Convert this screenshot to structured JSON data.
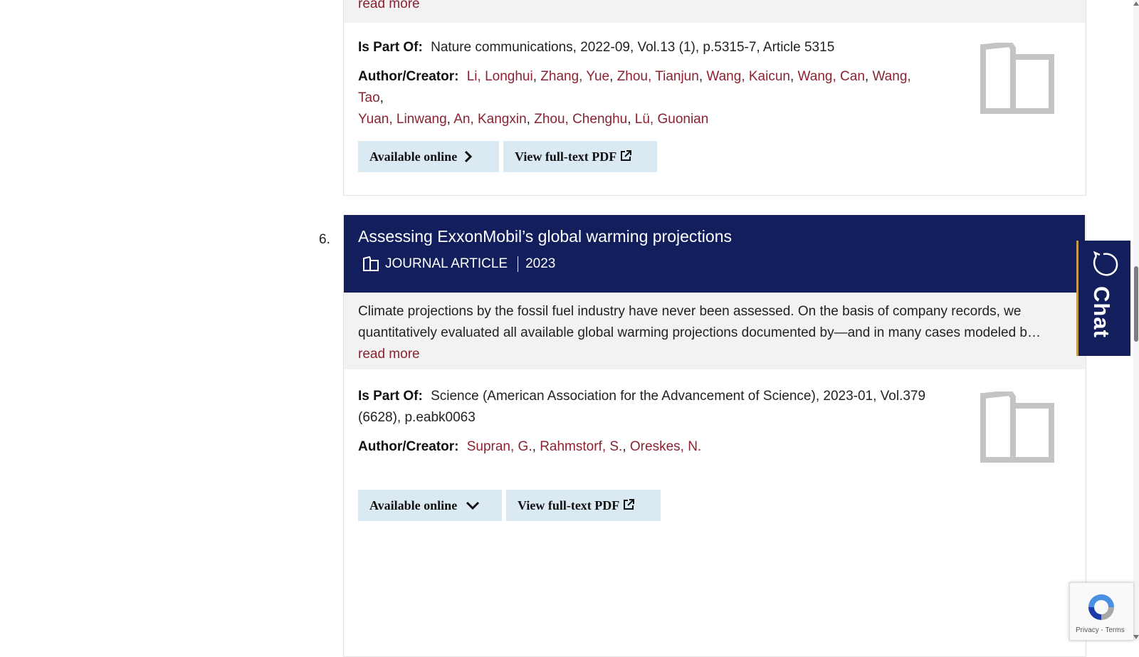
{
  "result5": {
    "read_more": "read more",
    "is_part_of_label": "Is Part Of:",
    "is_part_of": "Nature communications, 2022-09, Vol.13 (1), p.5315-7, Article 5315",
    "author_label": "Author/Creator:",
    "authors": [
      "Li, Longhui",
      "Zhang, Yue",
      "Zhou, Tianjun",
      "Wang, Kaicun",
      "Wang, Can",
      "Wang, Tao",
      "Yuan, Linwang",
      "An, Kangxin",
      "Zhou, Chenghu",
      "Lü, Guonian"
    ],
    "available_online": "Available online",
    "view_pdf": "View full-text PDF"
  },
  "result6": {
    "number": "6.",
    "title": "Assessing ExxonMobil’s global warming projections",
    "type": "JOURNAL ARTICLE",
    "year": "2023",
    "abstract_line1": "Climate projections by the fossil fuel industry have never been assessed. On the basis of company records, we",
    "abstract_line2": "quantitatively evaluated all available global warming projections documented by—and in many cases modeled b…",
    "read_more": "read more",
    "is_part_of_label": "Is Part Of:",
    "is_part_of": "Science (American Association for the Advancement of Science), 2023-01, Vol.379 (6628), p.eabk0063",
    "author_label": "Author/Creator:",
    "authors": [
      "Supran, G.",
      "Rahmstorf, S.",
      "Oreskes, N."
    ],
    "available_online": "Available online",
    "view_pdf": "View full-text PDF"
  },
  "chat": {
    "label": "Chat"
  },
  "recaptcha": {
    "links": "Privacy - Terms"
  },
  "colors": {
    "header_bg": "#121f5c",
    "link": "#8a2331",
    "button_bg": "#dbe9f3",
    "teaser_bg": "#f2f2f2",
    "chat_accent": "#c79a4b"
  },
  "icons": [
    "book-thumbnail-icon",
    "chevron-right-icon",
    "chevron-down-icon",
    "external-link-icon",
    "journal-article-icon",
    "chat-bubble-icon",
    "recaptcha-icon"
  ]
}
